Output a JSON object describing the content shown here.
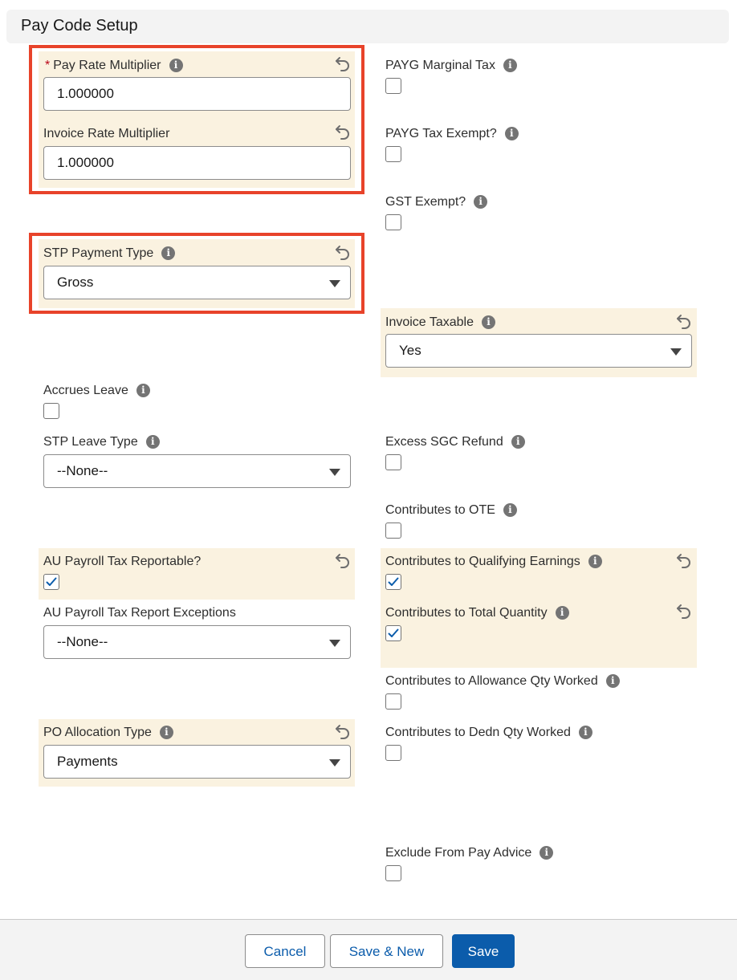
{
  "header": {
    "title": "Pay Code Setup"
  },
  "fields": {
    "pay_rate_multiplier": {
      "required_marker": "*",
      "label": "Pay Rate Multiplier",
      "value": "1.000000"
    },
    "invoice_rate_multiplier": {
      "label": "Invoice Rate Multiplier",
      "value": "1.000000"
    },
    "stp_payment_type": {
      "label": "STP Payment Type",
      "value": "Gross"
    },
    "accrues_leave": {
      "label": "Accrues Leave",
      "checked": false
    },
    "stp_leave_type": {
      "label": "STP Leave Type",
      "value": "--None--"
    },
    "au_payroll_tax_reportable": {
      "label": "AU Payroll Tax Reportable?",
      "checked": true
    },
    "au_payroll_tax_report_exceptions": {
      "label": "AU Payroll Tax Report Exceptions",
      "value": "--None--"
    },
    "po_allocation_type": {
      "label": "PO Allocation Type",
      "value": "Payments"
    },
    "payg_marginal_tax": {
      "label": "PAYG Marginal Tax",
      "checked": false
    },
    "payg_tax_exempt": {
      "label": "PAYG Tax Exempt?",
      "checked": false
    },
    "gst_exempt": {
      "label": "GST Exempt?",
      "checked": false
    },
    "invoice_taxable": {
      "label": "Invoice Taxable",
      "value": "Yes"
    },
    "excess_sgc_refund": {
      "label": "Excess SGC Refund",
      "checked": false
    },
    "contributes_to_ote": {
      "label": "Contributes to OTE",
      "checked": false
    },
    "contributes_to_qualifying_earnings": {
      "label": "Contributes to Qualifying Earnings",
      "checked": true
    },
    "contributes_to_total_quantity": {
      "label": "Contributes to Total Quantity",
      "checked": true
    },
    "contributes_to_allowance_qty_worked": {
      "label": "Contributes to Allowance Qty Worked",
      "checked": false
    },
    "contributes_to_dedn_qty_worked": {
      "label": "Contributes to Dedn Qty Worked",
      "checked": false
    },
    "exclude_from_pay_advice": {
      "label": "Exclude From Pay Advice",
      "checked": false
    }
  },
  "icons": {
    "info": "info-icon",
    "undo": "undo-icon",
    "caret": "chevron-down-icon",
    "check": "check-icon"
  },
  "info_glyph": "i",
  "footer": {
    "cancel_label": "Cancel",
    "save_new_label": "Save & New",
    "save_label": "Save"
  },
  "colors": {
    "highlight_bg": "#faf2e0",
    "annotation_border": "#e8432a",
    "brand_blue": "#0b5cab"
  }
}
